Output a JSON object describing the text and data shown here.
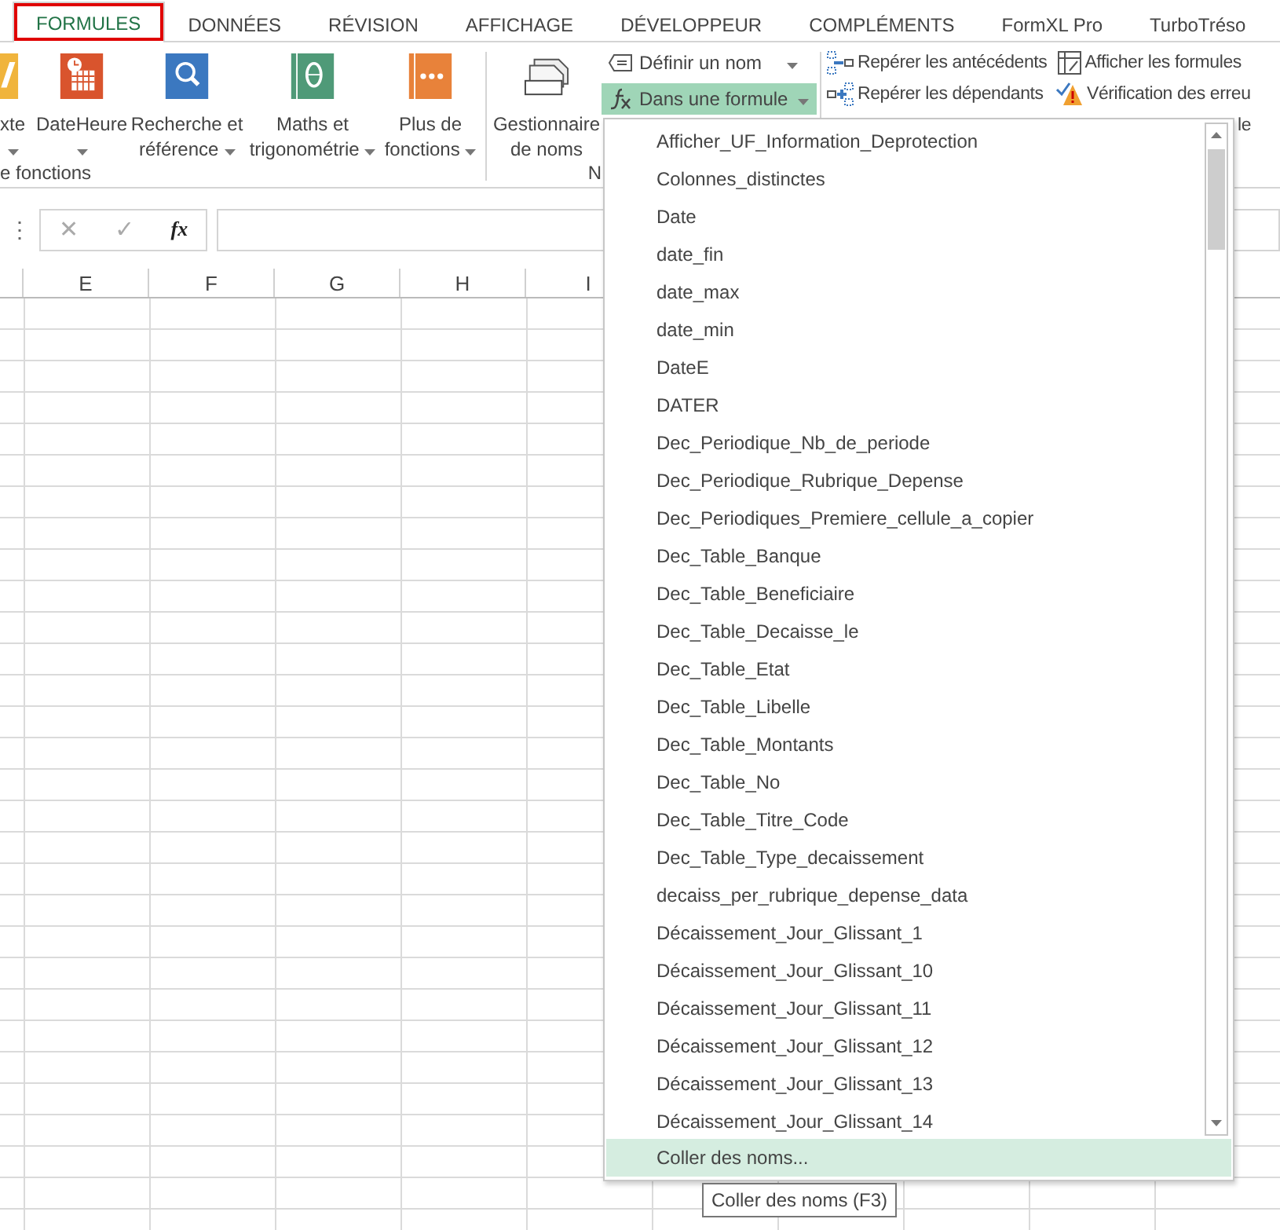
{
  "tabs": [
    {
      "label": "FORMULES",
      "selected": true,
      "outlined": true
    },
    {
      "label": "DONNÉES",
      "selected": false,
      "outlined": false
    },
    {
      "label": "RÉVISION",
      "selected": false,
      "outlined": false
    },
    {
      "label": "AFFICHAGE",
      "selected": false,
      "outlined": false
    },
    {
      "label": "DÉVELOPPEUR",
      "selected": false,
      "outlined": false
    },
    {
      "label": "COMPLÉMENTS",
      "selected": false,
      "outlined": false
    },
    {
      "label": "FormXL Pro",
      "selected": false,
      "outlined": false
    },
    {
      "label": "TurboTréso",
      "selected": false,
      "outlined": false
    }
  ],
  "ribbon": {
    "function_group": {
      "label": "e fonctions",
      "buttons": [
        {
          "kind": "text",
          "lines": [
            "xte"
          ],
          "menu": true,
          "caret_own_line": true
        },
        {
          "kind": "datetime",
          "lines": [
            "DateHeure"
          ],
          "menu": true,
          "caret_own_line": true
        },
        {
          "kind": "lookup",
          "lines": [
            "Recherche et",
            "référence"
          ],
          "menu": true,
          "caret_own_line": false
        },
        {
          "kind": "math",
          "lines": [
            "Maths et",
            "trigonométrie"
          ],
          "menu": true,
          "caret_own_line": false
        },
        {
          "kind": "more",
          "lines": [
            "Plus de",
            "fonctions"
          ],
          "menu": true,
          "caret_own_line": false
        }
      ]
    },
    "names_group": {
      "label": "N",
      "manager": {
        "lines": [
          "Gestionnaire",
          "de noms"
        ]
      },
      "commands": [
        {
          "kind": "define",
          "label": "Définir un nom",
          "menu": true,
          "pressed": false
        },
        {
          "kind": "formula",
          "label": "Dans une formule",
          "menu": true,
          "pressed": true
        }
      ]
    },
    "audit_group": {
      "commands": [
        {
          "kind": "precedents",
          "label": "Repérer les antécédents"
        },
        {
          "kind": "dependents",
          "label": "Repérer les dépendants"
        },
        {
          "kind": "show",
          "label": "Afficher les formules"
        },
        {
          "kind": "check",
          "label": "Vérification des erreu"
        },
        {
          "kind": "hidden",
          "label": "le"
        }
      ]
    }
  },
  "formula_bar": {
    "handle": "⋮",
    "buttons": [
      {
        "label": "✕",
        "disabled": true
      },
      {
        "label": "✓",
        "disabled": true
      },
      {
        "label": "fx",
        "disabled": false
      }
    ]
  },
  "columns": [
    "E",
    "F",
    "G",
    "H",
    "I"
  ],
  "dropdown": {
    "items": [
      "Afficher_UF_Information_Deprotection",
      "Colonnes_distinctes",
      "Date",
      "date_fin",
      "date_max",
      "date_min",
      "DateE",
      "DATER",
      "Dec_Periodique_Nb_de_periode",
      "Dec_Periodique_Rubrique_Depense",
      "Dec_Periodiques_Premiere_cellule_a_copier",
      "Dec_Table_Banque",
      "Dec_Table_Beneficiaire",
      "Dec_Table_Decaisse_le",
      "Dec_Table_Etat",
      "Dec_Table_Libelle",
      "Dec_Table_Montants",
      "Dec_Table_No",
      "Dec_Table_Titre_Code",
      "Dec_Table_Type_decaissement",
      "decaiss_per_rubrique_depense_data",
      "Décaissement_Jour_Glissant_1",
      "Décaissement_Jour_Glissant_10",
      "Décaissement_Jour_Glissant_11",
      "Décaissement_Jour_Glissant_12",
      "Décaissement_Jour_Glissant_13",
      "Décaissement_Jour_Glissant_14"
    ],
    "footer": {
      "label": "Coller des noms...",
      "highlighted": true
    }
  },
  "tooltip": "Coller des noms (F3)"
}
